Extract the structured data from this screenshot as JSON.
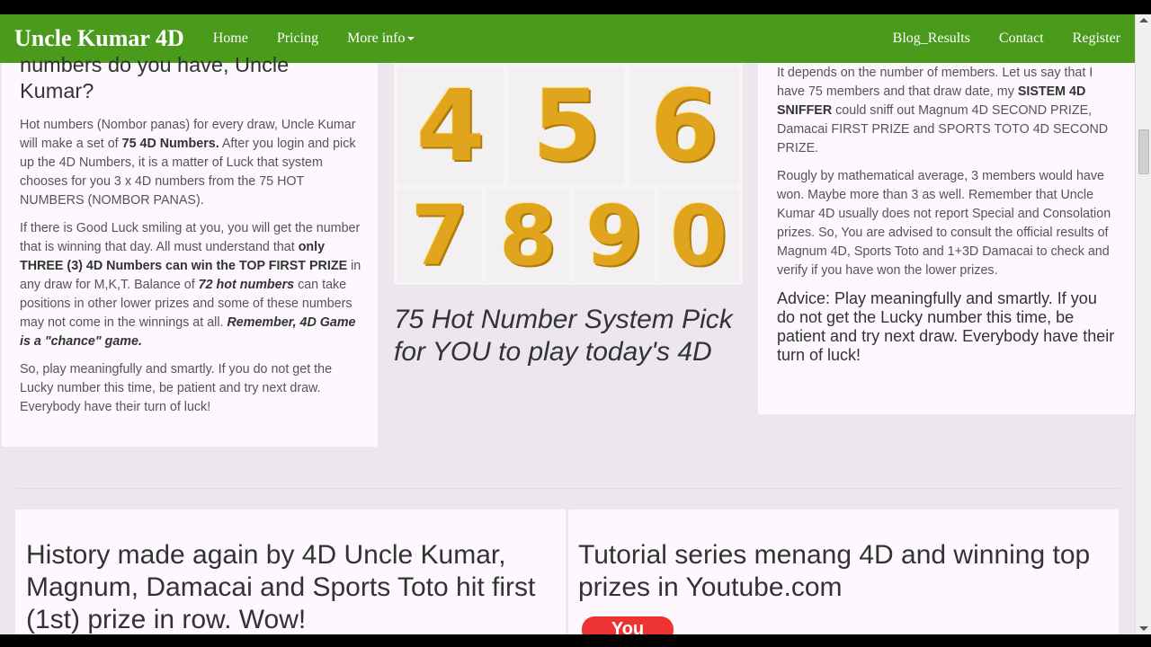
{
  "nav": {
    "brand": "Uncle Kumar 4D",
    "home": "Home",
    "pricing": "Pricing",
    "more_info": "More info",
    "blog_results": "Blog_Results",
    "contact": "Contact",
    "register": "Register"
  },
  "left": {
    "heading": "numbers do you have, Uncle Kumar?",
    "p1_a": "Hot numbers (Nombor panas) for every draw, Uncle Kumar will make a set of ",
    "p1_b": "75 4D Numbers.",
    "p1_c": " After you login and pick up the 4D Numbers, it is a matter of Luck that system chooses for you 3 x 4D numbers from the 75 HOT NUMBERS (NOMBOR PANAS).",
    "p2_a": "If there is Good Luck smiling at you, you will get the number that is winning that day. All must understand that ",
    "p2_b": "only  THREE (3) 4D Numbers can win the TOP FIRST PRIZE",
    "p2_c": " in any draw for M,K,T. Balance of ",
    "p2_d": "72 hot numbers",
    "p2_e": " can take positions in other lower prizes and some of these numbers may not come in the winnings at all. ",
    "p2_f": "Remember, 4D Game is a \"chance\" game.",
    "p3": "So, play meaningfully and smartly. If you do not get the Lucky number this time, be patient and try next draw. Everybody have their turn of luck!"
  },
  "center": {
    "digits": [
      "4",
      "5",
      "6",
      "7",
      "8",
      "9",
      "0"
    ],
    "caption": "75 Hot Number System Pick for YOU to play today's 4D"
  },
  "right": {
    "p1_a": "It depends on the number of members. Let us say that I have 75 members and that draw date, my ",
    "p1_b": "SISTEM 4D SNIFFER",
    "p1_c": " could sniff out Magnum 4D SECOND PRIZE, Damacai FIRST PRIZE and SPORTS TOTO 4D SECOND PRIZE.",
    "p2": "Rougly by mathematical average, 3 members would have won. Maybe more than 3 as well. Remember that Uncle Kumar 4D usually does not report Special and Consolation prizes. So, You are advised to consult the official results of Magnum 4D, Sports Toto and 1+3D Damacai to check and verify if you have won the lower prizes.",
    "advice": "Advice: Play meaningfully and smartly. If you do not get the Lucky number this time, be patient and try next draw. Everybody have their turn of luck!"
  },
  "bottom": {
    "left_heading": "History made again by 4D Uncle Kumar, Magnum, Damacai and Sports Toto hit first (1st) prize in row. Wow!",
    "right_heading": "Tutorial series menang 4D and winning top prizes in Youtube.com",
    "yt_label": "You"
  }
}
